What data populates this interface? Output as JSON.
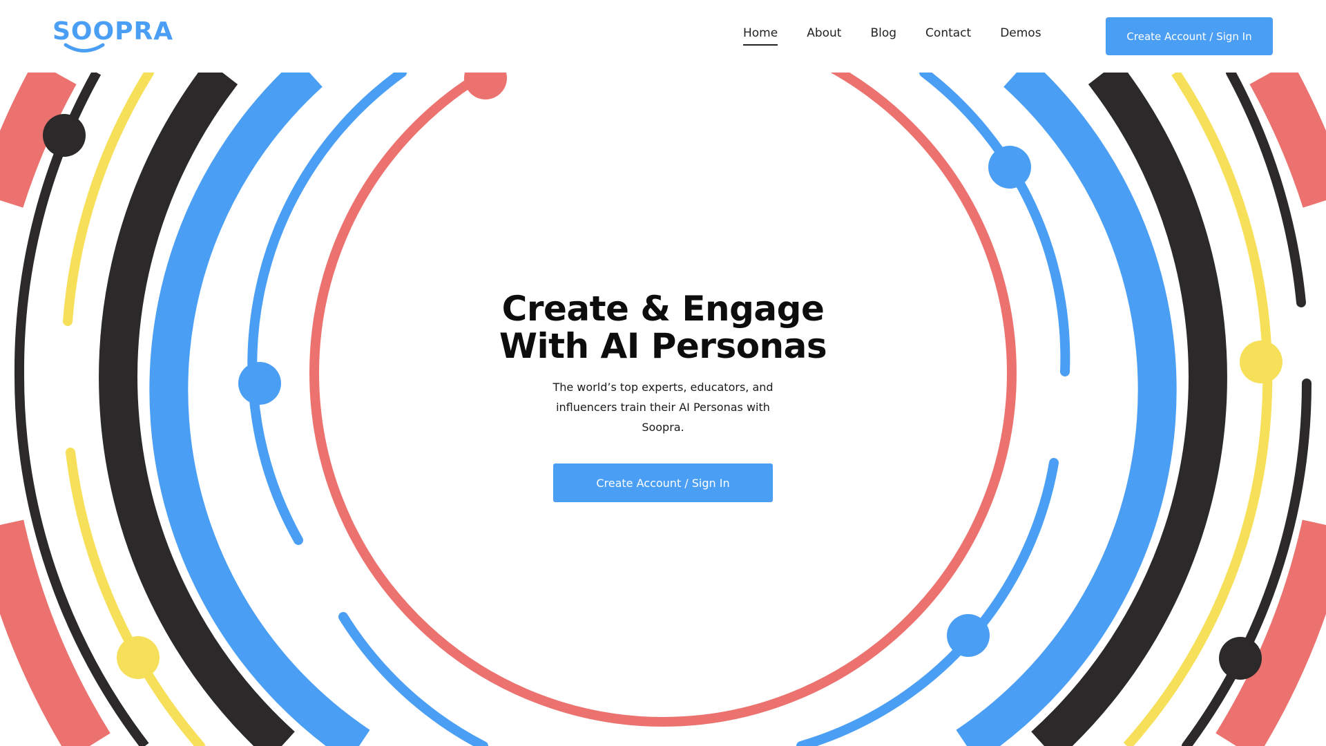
{
  "header": {
    "logo_text": "SOOPRA",
    "nav": [
      {
        "label": "Home",
        "active": true
      },
      {
        "label": "About",
        "active": false
      },
      {
        "label": "Blog",
        "active": false
      },
      {
        "label": "Contact",
        "active": false
      },
      {
        "label": "Demos",
        "active": false
      }
    ],
    "cta_label": "Create Account / Sign In"
  },
  "hero": {
    "title_line1": "Create & Engage",
    "title_line2": "With AI Personas",
    "subtitle": "The world’s top experts, educators, and influencers train their AI Personas with Soopra.",
    "cta_label": "Create Account / Sign In"
  },
  "colors": {
    "brand_blue": "#4a9ff5",
    "coral": "#ec726f",
    "yellow": "#f6e05a",
    "charcoal": "#2b2929"
  },
  "icons": {
    "logo_mark": "smile-icon"
  }
}
